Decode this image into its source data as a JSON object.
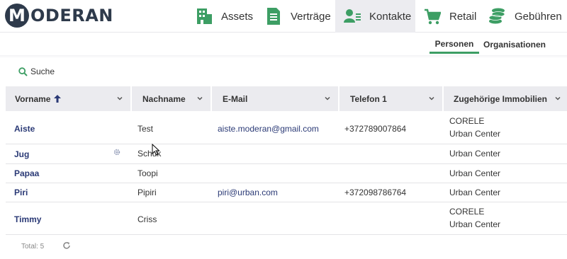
{
  "brand": {
    "logo_letter": "M",
    "logo_text": "ODERAN"
  },
  "nav": [
    {
      "label": "Assets",
      "icon": "building-icon"
    },
    {
      "label": "Verträge",
      "icon": "document-icon"
    },
    {
      "label": "Kontakte",
      "icon": "contacts-icon",
      "active": true
    },
    {
      "label": "Retail",
      "icon": "cart-icon"
    },
    {
      "label": "Gebühren",
      "icon": "coins-icon"
    }
  ],
  "subtabs": [
    {
      "label": "Personen",
      "active": true
    },
    {
      "label": "Organisationen"
    }
  ],
  "search": {
    "label": "Suche"
  },
  "table": {
    "columns": [
      "Vorname",
      "Nachname",
      "E-Mail",
      "Telefon 1",
      "Zugehörige Immobilien"
    ],
    "sorted_column": "Vorname",
    "sort_direction": "ascending",
    "rows": [
      {
        "vorname": "Aiste",
        "nachname": "Test",
        "email": "aiste.moderan@gmail.com",
        "telefon": "+372789007864",
        "immobilien": [
          "CORELE",
          "Urban Center"
        ]
      },
      {
        "vorname": "Jug",
        "nachname": "Schuk",
        "email": "",
        "telefon": "",
        "immobilien": [
          "Urban Center"
        ]
      },
      {
        "vorname": "Papaa",
        "nachname": "Toopi",
        "email": "",
        "telefon": "",
        "immobilien": [
          "Urban Center"
        ]
      },
      {
        "vorname": "Piri",
        "nachname": "Pipiri",
        "email": "piri@urban.com",
        "telefon": "+372098786764",
        "immobilien": [
          "Urban Center"
        ]
      },
      {
        "vorname": "Timmy",
        "nachname": "Criss",
        "email": "",
        "telefon": "",
        "immobilien": [
          "CORELE",
          "Urban Center"
        ]
      }
    ]
  },
  "footer": {
    "total": "Total: 5"
  },
  "colors": {
    "accent_green": "#3d9e64",
    "link_blue": "#2b3a76",
    "header_bg": "#ebebef",
    "brand_dark": "#2e3a4b"
  }
}
